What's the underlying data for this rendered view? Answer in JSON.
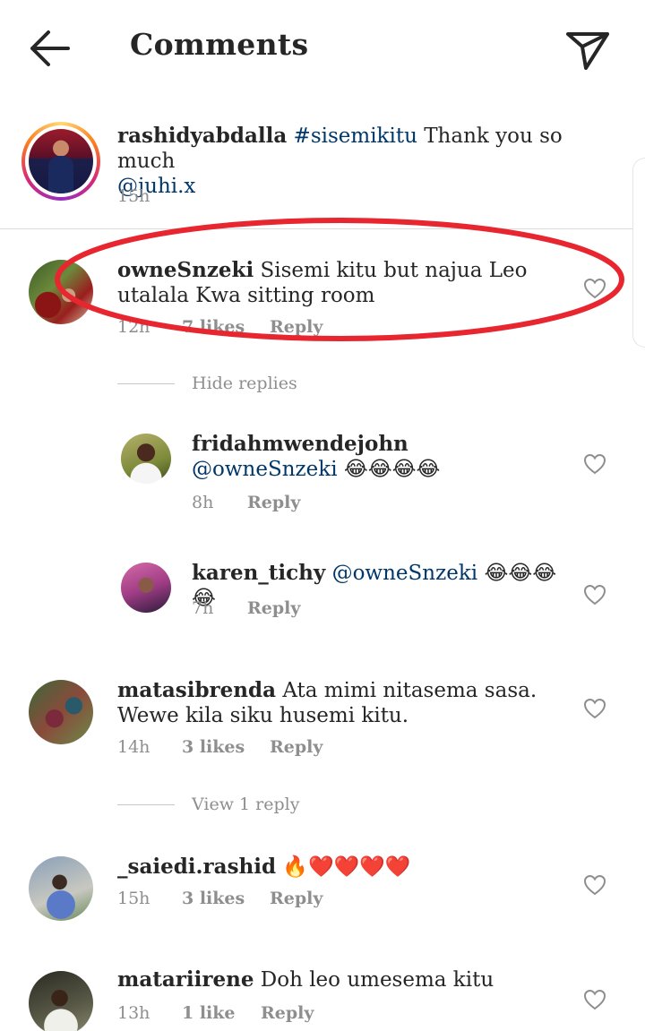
{
  "header": {
    "title": "Comments",
    "back_icon": "arrow-left-icon",
    "share_icon": "paper-plane-icon"
  },
  "caption": {
    "username": "rashidyabdalla",
    "hashtag": "#sisemikitu",
    "text": " Thank you so much",
    "mention": "@juhi.x",
    "time": "15h"
  },
  "comments": [
    {
      "username": "owneSnzeki",
      "text": "Sisemi kitu but najua Leo utalala Kwa sitting room",
      "time": "12h",
      "likes": "7 likes",
      "reply": "Reply"
    },
    {
      "username": "matasibrenda",
      "text": "Ata mimi nitasema sasa. Wewe kila siku husemi kitu.",
      "time": "14h",
      "likes": "3 likes",
      "reply": "Reply"
    },
    {
      "username": "_saiedi.rashid",
      "text": "🔥❤️❤️❤️❤️",
      "time": "15h",
      "likes": "3 likes",
      "reply": "Reply"
    },
    {
      "username": "matariirene",
      "text": "Doh leo umesema kitu",
      "time": "13h",
      "likes": "1 like",
      "reply": "Reply"
    }
  ],
  "thread1": {
    "toggle": "Hide replies",
    "replies": [
      {
        "username": "fridahmwendejohn",
        "mention": "@owneSnzeki",
        "text": " 😂😂😂😂",
        "time": "8h",
        "reply": "Reply"
      },
      {
        "username": "karen_tichy",
        "mention": "@owneSnzeki",
        "text": " 😂😂😂😂",
        "time": "7h",
        "reply": "Reply"
      }
    ]
  },
  "thread2": {
    "toggle": "View 1 reply"
  },
  "colors": {
    "link": "#00376b",
    "muted": "#8e8e8e",
    "annotation": "#e8262f"
  }
}
